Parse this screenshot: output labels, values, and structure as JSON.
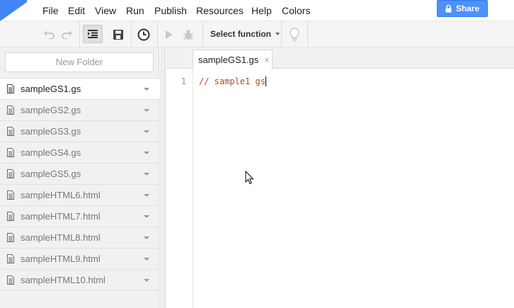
{
  "menus": [
    "File",
    "Edit",
    "View",
    "Run",
    "Publish",
    "Resources",
    "Help",
    "Colors"
  ],
  "share": {
    "label": "Share"
  },
  "toolbar": {
    "select_function": "Select function",
    "icons": [
      "undo-icon",
      "redo-icon",
      "indent-icon",
      "save-icon",
      "triggers-clock-icon",
      "run-icon",
      "debug-bug-icon",
      "lightbulb-icon"
    ]
  },
  "sidebar": {
    "new_folder": "New Folder",
    "files": [
      {
        "name": "sampleGS1.gs",
        "active": true
      },
      {
        "name": "sampleGS2.gs",
        "active": false
      },
      {
        "name": "sampleGS3.gs",
        "active": false
      },
      {
        "name": "sampleGS4.gs",
        "active": false
      },
      {
        "name": "sampleGS5.gs",
        "active": false
      },
      {
        "name": "sampleHTML6.html",
        "active": false
      },
      {
        "name": "sampleHTML7.html",
        "active": false
      },
      {
        "name": "sampleHTML8.html",
        "active": false
      },
      {
        "name": "sampleHTML9.html",
        "active": false
      },
      {
        "name": "sampleHTML10.html",
        "active": false
      }
    ]
  },
  "editor": {
    "tab_label": "sampleGS1.gs",
    "tab_close": "×",
    "line_number": "1",
    "code_line": "// sample1 gs"
  },
  "colors": {
    "brand": "#4285f4",
    "share": "#4d90fe",
    "comment": "#a0522d"
  }
}
